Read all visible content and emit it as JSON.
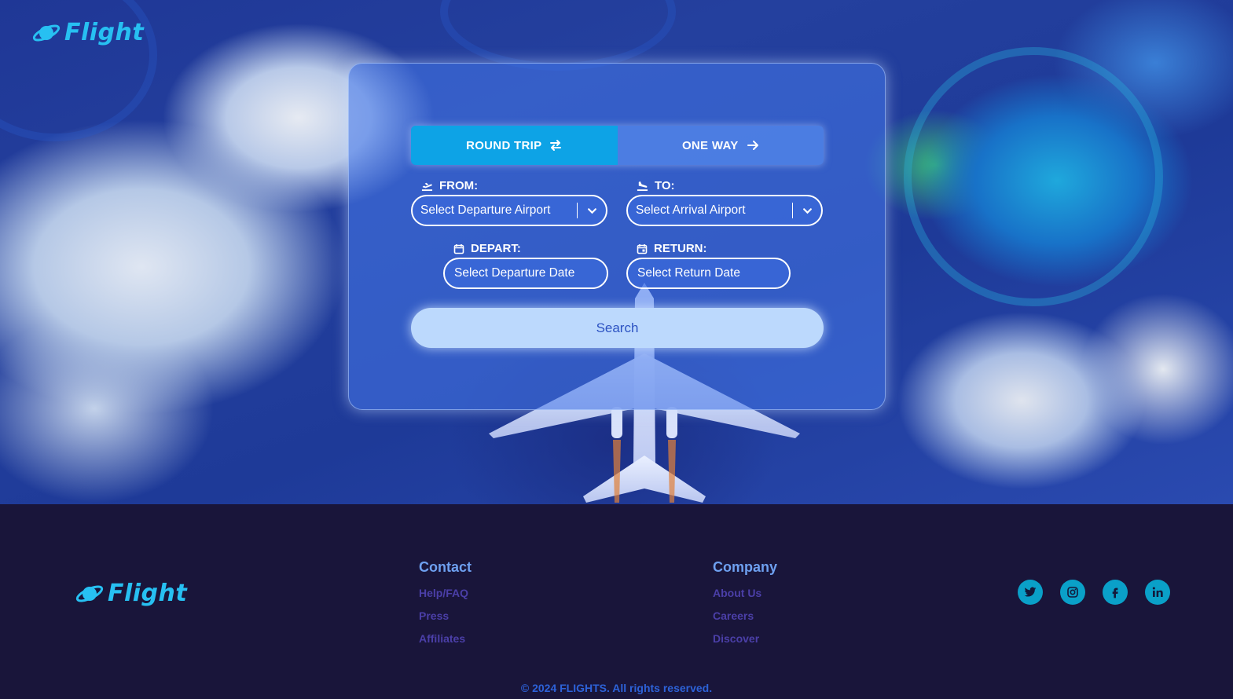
{
  "brand": {
    "name": "Flight",
    "accent": "#27c0f2",
    "icon": "planet-icon"
  },
  "trip_tabs": [
    {
      "label": "ROUND TRIP",
      "icon": "swap-arrows-icon",
      "active": true
    },
    {
      "label": "ONE WAY",
      "icon": "arrow-right-icon",
      "active": false
    }
  ],
  "form": {
    "from": {
      "label": "FROM:",
      "placeholder": "Select Departure Airport",
      "icon": "takeoff-icon"
    },
    "to": {
      "label": "TO:",
      "placeholder": "Select Arrival Airport",
      "icon": "landing-icon"
    },
    "depart": {
      "label": "DEPART:",
      "placeholder": "Select Departure Date",
      "icon": "calendar-icon"
    },
    "return": {
      "label": "RETURN:",
      "placeholder": "Select Return Date",
      "icon": "calendar-icon"
    },
    "search_label": "Search"
  },
  "footer": {
    "brand_name": "Flight",
    "contact": {
      "title": "Contact",
      "links": [
        "Help/FAQ",
        "Press",
        "Affiliates"
      ]
    },
    "company": {
      "title": "Company",
      "links": [
        "About Us",
        "Careers",
        "Discover"
      ]
    },
    "social": [
      "twitter-icon",
      "instagram-icon",
      "facebook-icon",
      "linkedin-icon"
    ],
    "copyright": "© 2024 FLIGHTS. All rights reserved."
  },
  "colors": {
    "tab_active": "#0da3e6",
    "footer_bg": "#19153a",
    "link": "#4b3fa8",
    "heading": "#6ea0f0"
  }
}
